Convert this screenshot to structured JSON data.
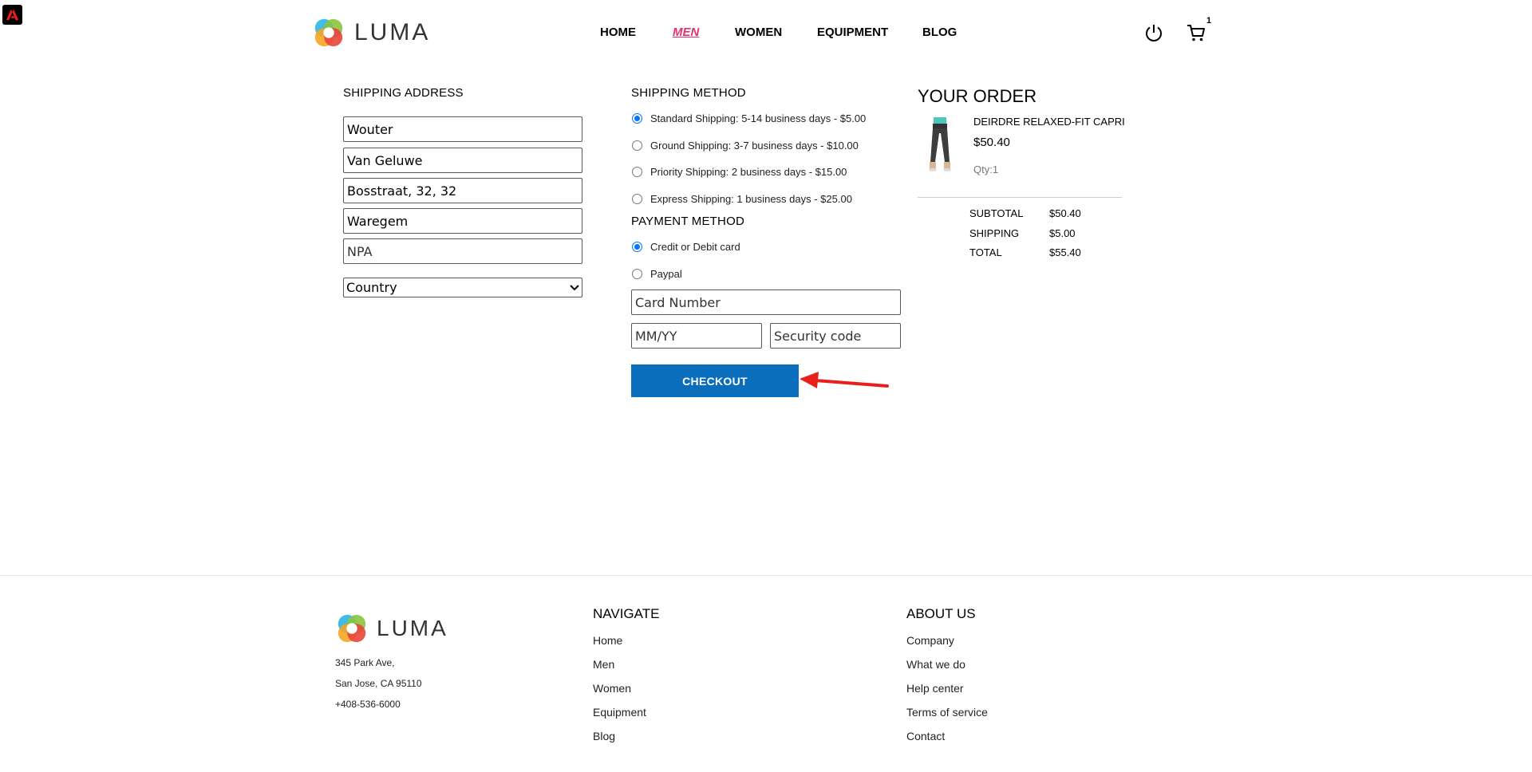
{
  "colors": {
    "accent": "#0a6ebd",
    "active_nav": "#e8316a",
    "radio_checked": "#0075ff",
    "annotation_arrow": "#e8201c"
  },
  "header": {
    "logo_text": "LUMA",
    "nav": [
      "HOME",
      "MEN",
      "WOMEN",
      "EQUIPMENT",
      "BLOG"
    ],
    "active_nav": "MEN",
    "icons": [
      "power-icon",
      "cart-icon"
    ],
    "cart_count": "1"
  },
  "shipping_address": {
    "title": "SHIPPING ADDRESS",
    "first_name": "Wouter",
    "last_name": "Van Geluwe",
    "street": "Bosstraat, 32, 32",
    "city": "Waregem",
    "zip_placeholder": "NPA",
    "country_selected": "Country"
  },
  "shipping_method": {
    "title": "SHIPPING METHOD",
    "options": [
      {
        "label": "Standard Shipping: 5-14 business days - $5.00",
        "checked": true
      },
      {
        "label": "Ground Shipping: 3-7 business days - $10.00",
        "checked": false
      },
      {
        "label": "Priority Shipping: 2 business days - $15.00",
        "checked": false
      },
      {
        "label": "Express Shipping: 1 business days - $25.00",
        "checked": false
      }
    ]
  },
  "payment_method": {
    "title": "PAYMENT METHOD",
    "options": [
      {
        "label": "Credit or Debit card",
        "checked": true
      },
      {
        "label": "Paypal",
        "checked": false
      }
    ],
    "card_number_placeholder": "Card Number",
    "expiry_placeholder": "MM/YY",
    "security_placeholder": "Security code",
    "checkout_label": "CHECKOUT"
  },
  "order": {
    "title": "YOUR ORDER",
    "item_name": "DEIRDRE RELAXED-FIT CAPRI",
    "item_price": "$50.40",
    "item_qty": "Qty:1",
    "subtotal_label": "SUBTOTAL",
    "subtotal_value": "$50.40",
    "shipping_label": "SHIPPING",
    "shipping_value": "$5.00",
    "total_label": "TOTAL",
    "total_value": "$55.40"
  },
  "footer": {
    "logo_text": "LUMA",
    "address_line1": "345 Park Ave,",
    "address_line2": "San Jose, CA 95110",
    "phone": "+408-536-6000",
    "navigate_title": "NAVIGATE",
    "navigate_links": [
      "Home",
      "Men",
      "Women",
      "Equipment",
      "Blog"
    ],
    "about_title": "ABOUT US",
    "about_links": [
      "Company",
      "What we do",
      "Help center",
      "Terms of service",
      "Contact"
    ]
  }
}
